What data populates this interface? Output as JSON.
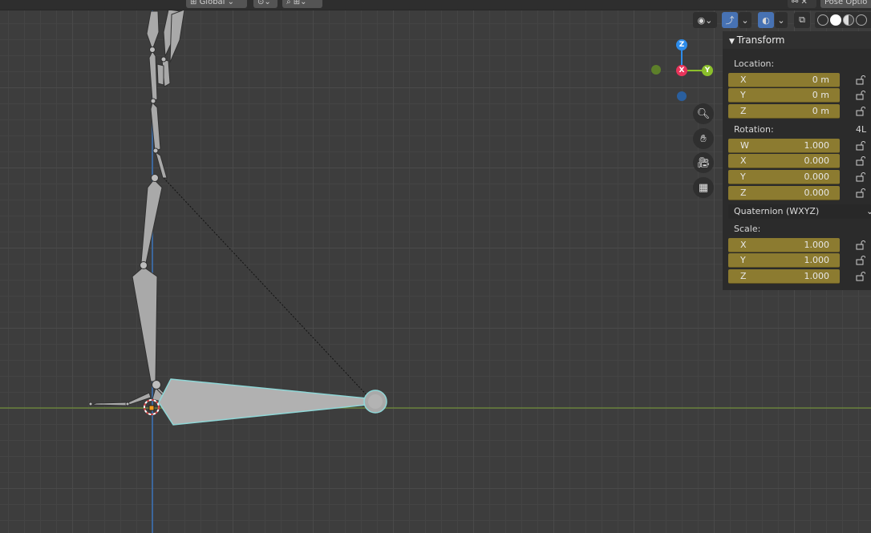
{
  "header": {
    "orientation": "Global",
    "pose_options": "Pose Optio"
  },
  "gizmo": {
    "z": "Z",
    "x": "X",
    "y": "Y"
  },
  "nav": {
    "zoom_icon": "zoom-icon",
    "pan_icon": "hand-icon",
    "camera_icon": "camera-icon",
    "grid_icon": "grid-icon"
  },
  "panel": {
    "title": "Transform",
    "location_label": "Location:",
    "location": [
      {
        "axis": "X",
        "value": "0 m"
      },
      {
        "axis": "Y",
        "value": "0 m"
      },
      {
        "axis": "Z",
        "value": "0 m"
      }
    ],
    "rotation_label": "Rotation:",
    "rotation_lock_badge": "4L",
    "rotation": [
      {
        "axis": "W",
        "value": "1.000"
      },
      {
        "axis": "X",
        "value": "0.000"
      },
      {
        "axis": "Y",
        "value": "0.000"
      },
      {
        "axis": "Z",
        "value": "0.000"
      }
    ],
    "rotation_mode": "Quaternion (WXYZ)",
    "scale_label": "Scale:",
    "scale": [
      {
        "axis": "X",
        "value": "1.000"
      },
      {
        "axis": "Y",
        "value": "1.000"
      },
      {
        "axis": "Z",
        "value": "1.000"
      }
    ]
  },
  "colors": {
    "viewport_bg": "#3d3d3d",
    "field_bg": "#8c7b30",
    "x_axis": "#e8345a",
    "y_axis": "#8bbf2b",
    "z_axis": "#2d8ceb",
    "selected_bone_outline": "#8fd7d7"
  }
}
